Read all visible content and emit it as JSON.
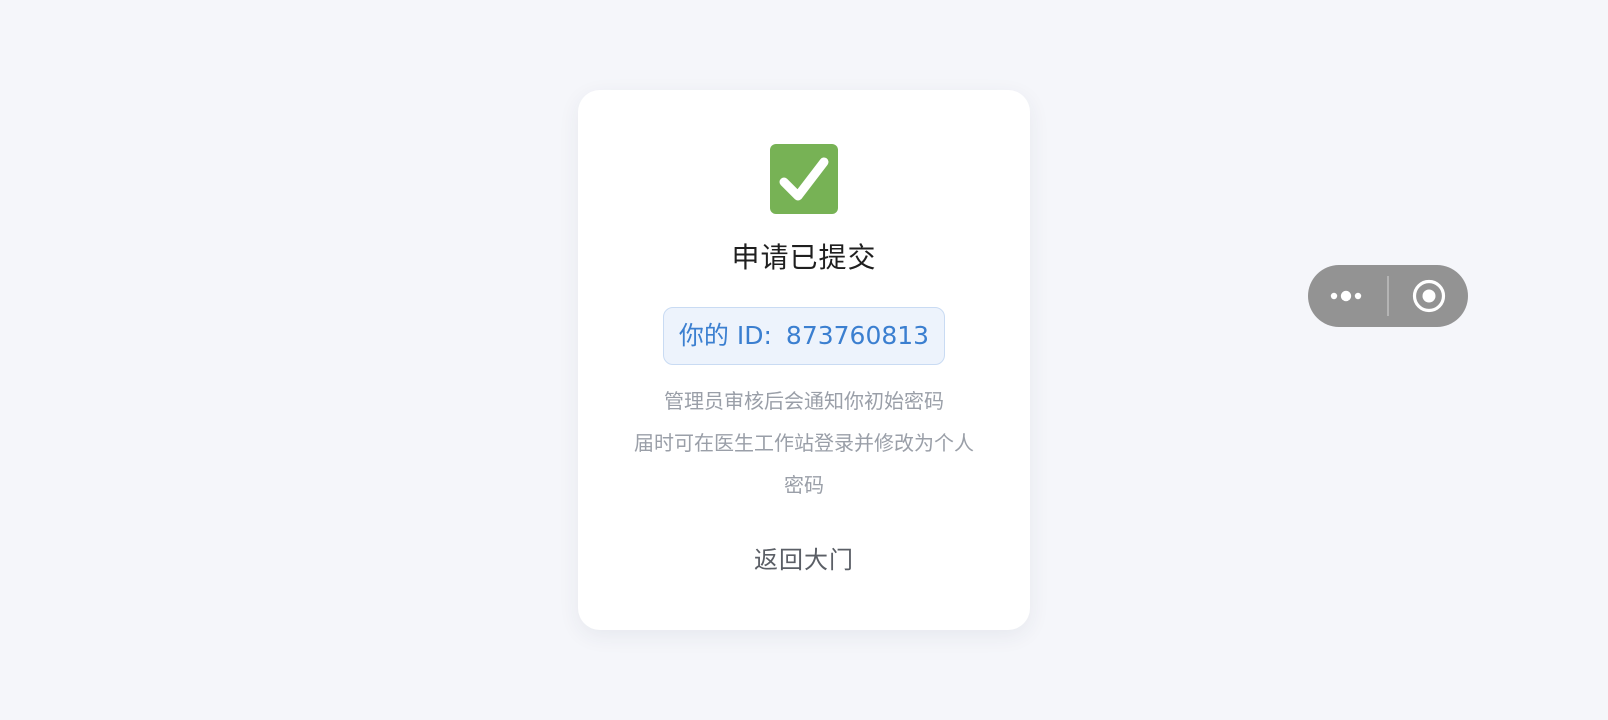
{
  "result_card": {
    "title": "申请已提交",
    "id_label": "你的 ID:",
    "id_value": "873760813",
    "description_lines": [
      "管理员审核后会通知你初始密码",
      "届时可在医生工作站登录并修改为个人",
      "密码"
    ],
    "back_label": "返回大门",
    "icon": "check-mark-icon"
  },
  "capsule": {
    "icons": [
      "more-icon",
      "close-target-icon"
    ]
  },
  "colors": {
    "background": "#f5f6fa",
    "check_green": "#77b255",
    "id_text": "#3b7fd0",
    "id_bg": "#edf3fc",
    "capsule": "#939393"
  }
}
